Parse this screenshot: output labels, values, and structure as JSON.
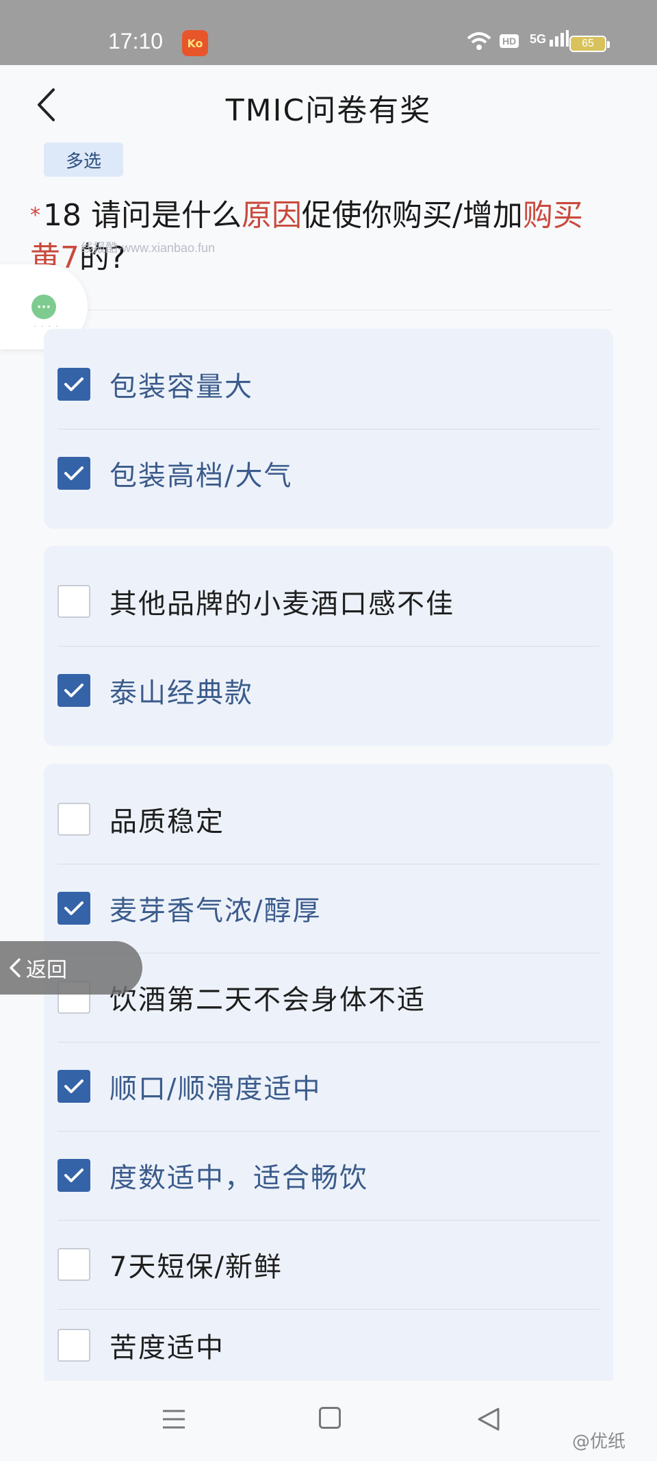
{
  "status_bar": {
    "time": "17:10",
    "app_badge": "Ko",
    "hd_label": "HD",
    "signal_label": "5G",
    "battery": "65"
  },
  "header": {
    "title": "TMIC问卷有奖"
  },
  "question": {
    "tag": "多选",
    "required_mark": "*",
    "number": "18",
    "text_part1": "请问是什么",
    "text_hl1": "原因",
    "text_part2": "促使你购买/增加",
    "text_hl2": "购买黄7",
    "text_part3": "的?",
    "watermark": "线报酷-www.xianbao.fun"
  },
  "groups": [
    {
      "options": [
        {
          "label": "包装容量大",
          "checked": true
        },
        {
          "label": "包装高档/大气",
          "checked": true
        }
      ]
    },
    {
      "options": [
        {
          "label": "其他品牌的小麦酒口感不佳",
          "checked": false
        },
        {
          "label": "泰山经典款",
          "checked": true
        }
      ]
    },
    {
      "options": [
        {
          "label": "品质稳定",
          "checked": false
        },
        {
          "label": "麦芽香气浓/醇厚",
          "checked": true
        },
        {
          "label": "饮酒第二天不会身体不适",
          "checked": false
        },
        {
          "label": "顺口/顺滑度适中",
          "checked": true
        },
        {
          "label": "度数适中，适合畅饮",
          "checked": true
        },
        {
          "label": "7天短保/新鲜",
          "checked": false
        },
        {
          "label": "苦度适中",
          "checked": false
        }
      ]
    }
  ],
  "float_back": {
    "label": "返回"
  },
  "footer": {
    "weibo_mark": "@优纸"
  },
  "colors": {
    "checked": "#3563a8",
    "selected_text": "#3b5b8b",
    "highlight": "#c94a3d",
    "group_bg": "#edf2fa"
  }
}
